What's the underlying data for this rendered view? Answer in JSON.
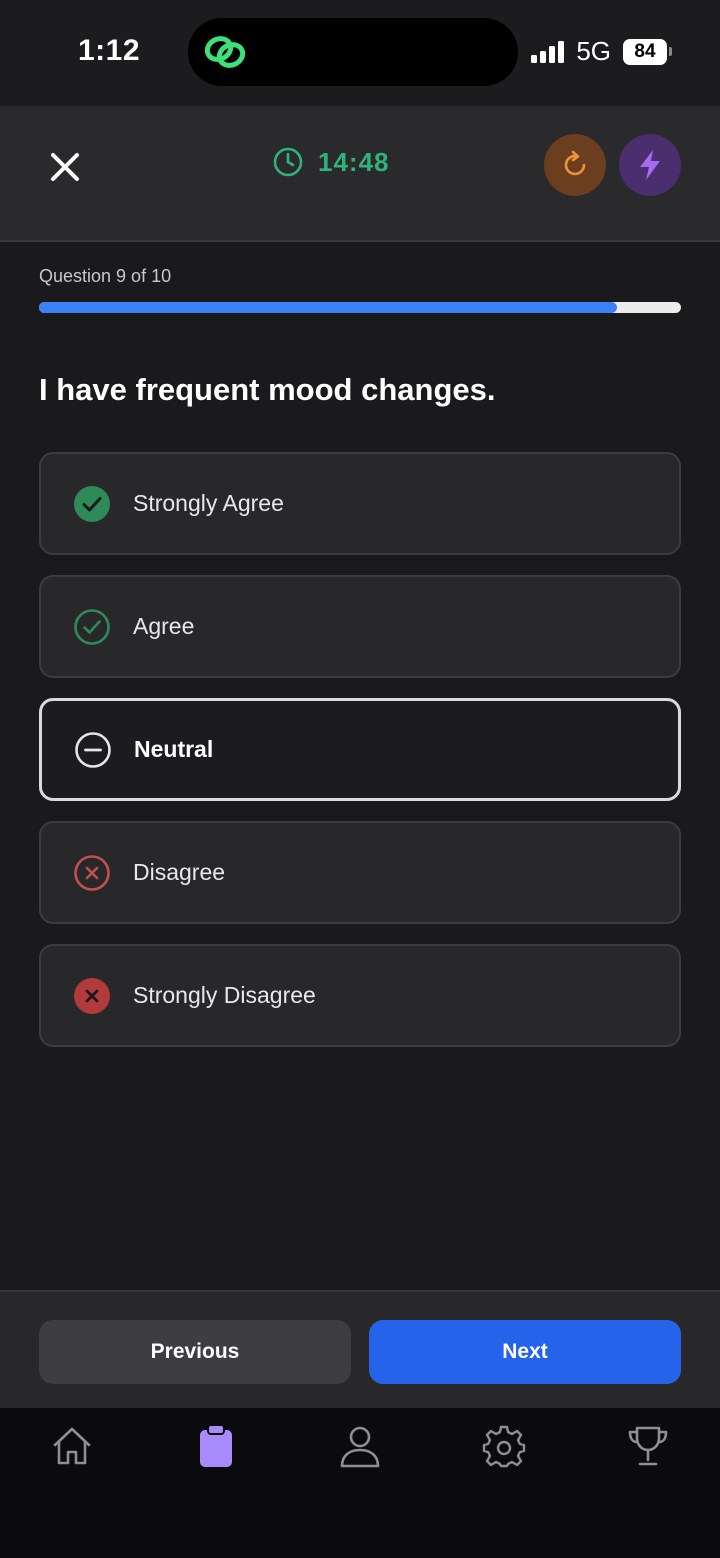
{
  "status_bar": {
    "time": "1:12",
    "network": "5G",
    "battery": "84"
  },
  "header": {
    "timer": "14:48",
    "icons": {
      "close": "close-icon",
      "timer": "clock-icon",
      "refresh": "refresh-icon",
      "boost": "lightning-icon"
    },
    "colors": {
      "timer": "#2fb37a",
      "refresh": "#f0923a",
      "boost": "#a66cf0"
    }
  },
  "progress": {
    "label": "Question 9 of 10",
    "value": 0.9
  },
  "question": {
    "text": "I have frequent mood changes."
  },
  "options": [
    {
      "label": "Strongly Agree",
      "icon": "check-circle-filled-icon",
      "color": "#2e8b57",
      "selected": false
    },
    {
      "label": "Agree",
      "icon": "check-circle-outline-icon",
      "color": "#2e8b57",
      "selected": false
    },
    {
      "label": "Neutral",
      "icon": "minus-circle-icon",
      "color": "#e6e6e6",
      "selected": true
    },
    {
      "label": "Disagree",
      "icon": "x-circle-outline-icon",
      "color": "#c0504d",
      "selected": false
    },
    {
      "label": "Strongly Disagree",
      "icon": "x-circle-filled-icon",
      "color": "#b23a3a",
      "selected": false
    }
  ],
  "actions": {
    "previous_label": "Previous",
    "next_label": "Next"
  },
  "tab_bar": {
    "tabs": [
      {
        "icon": "home-icon",
        "active": false
      },
      {
        "icon": "clipboard-icon",
        "active": true
      },
      {
        "icon": "profile-icon",
        "active": false
      },
      {
        "icon": "settings-icon",
        "active": false
      },
      {
        "icon": "trophy-icon",
        "active": false
      }
    ],
    "active_color": "#a78bfa"
  }
}
